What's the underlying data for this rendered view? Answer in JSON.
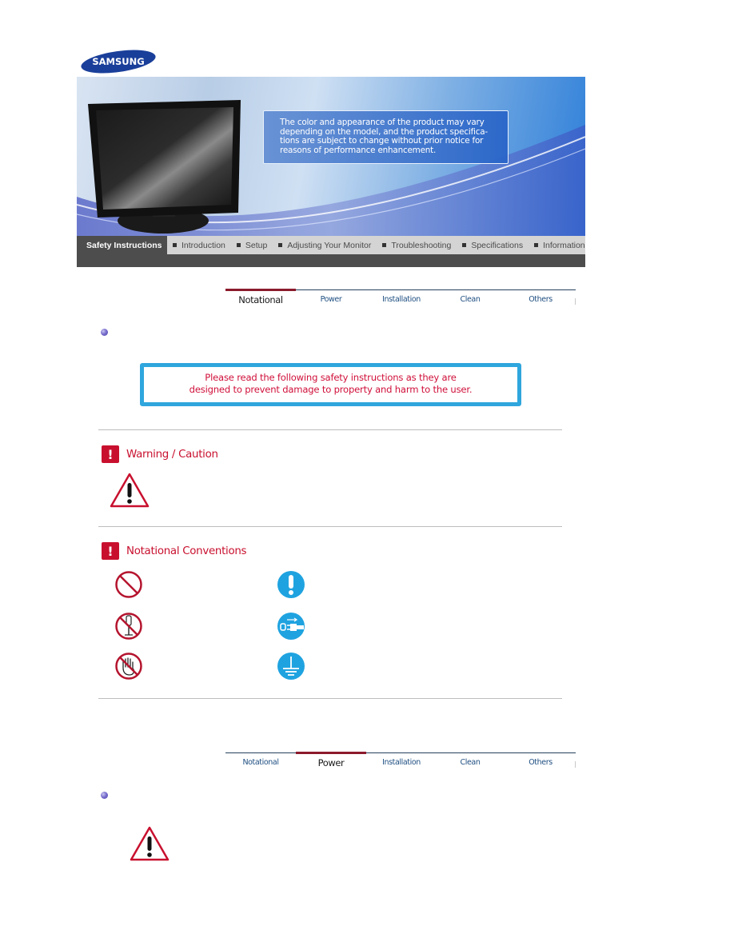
{
  "brand": {
    "logo_text": "SAMSUNG",
    "logo_color": "#1a3f9a"
  },
  "banner": {
    "notice_lines": [
      "The color and appearance of the product may vary",
      "depending on the model, and the product specifica-",
      "tions are subject to change without prior notice for",
      "reasons of performance enhancement."
    ]
  },
  "main_nav": {
    "items": [
      {
        "label": "Safety Instructions",
        "active": true
      },
      {
        "label": "Introduction",
        "active": false
      },
      {
        "label": "Setup",
        "active": false
      },
      {
        "label": "Adjusting Your Monitor",
        "active": false
      },
      {
        "label": "Troubleshooting",
        "active": false
      },
      {
        "label": "Specifications",
        "active": false
      },
      {
        "label": "Information",
        "active": false
      }
    ],
    "active_indicator_color": "#2aa0e8"
  },
  "tabs_top": {
    "items": [
      {
        "label": "Notational",
        "active": true
      },
      {
        "label": "Power",
        "active": false
      },
      {
        "label": "Installation",
        "active": false
      },
      {
        "label": "Clean",
        "active": false
      },
      {
        "label": "Others",
        "active": false
      }
    ]
  },
  "callout": {
    "line1": "Please read the following safety instructions as they are",
    "line2": "designed to prevent damage to property and harm to the user.",
    "text_color": "#d0103a",
    "border_color": "#2fa6dd"
  },
  "sections": {
    "warning": {
      "title": "Warning / Caution",
      "icon": "warning-triangle-icon"
    },
    "conventions": {
      "title": "Notational Conventions",
      "icons_left": [
        "prohibited-icon",
        "do-not-disassemble-icon",
        "do-not-touch-icon"
      ],
      "icons_right": [
        "important-icon",
        "unplug-icon",
        "ground-icon"
      ]
    }
  },
  "tabs_bottom": {
    "items": [
      {
        "label": "Notational",
        "active": false
      },
      {
        "label": "Power",
        "active": true
      },
      {
        "label": "Installation",
        "active": false
      },
      {
        "label": "Clean",
        "active": false
      },
      {
        "label": "Others",
        "active": false
      }
    ]
  },
  "colors": {
    "accent_red": "#c8102e",
    "tab_active_bar": "#8b1a2b",
    "nav_active_bg": "#4d4d4d",
    "info_blue": "#1fa3e0"
  }
}
